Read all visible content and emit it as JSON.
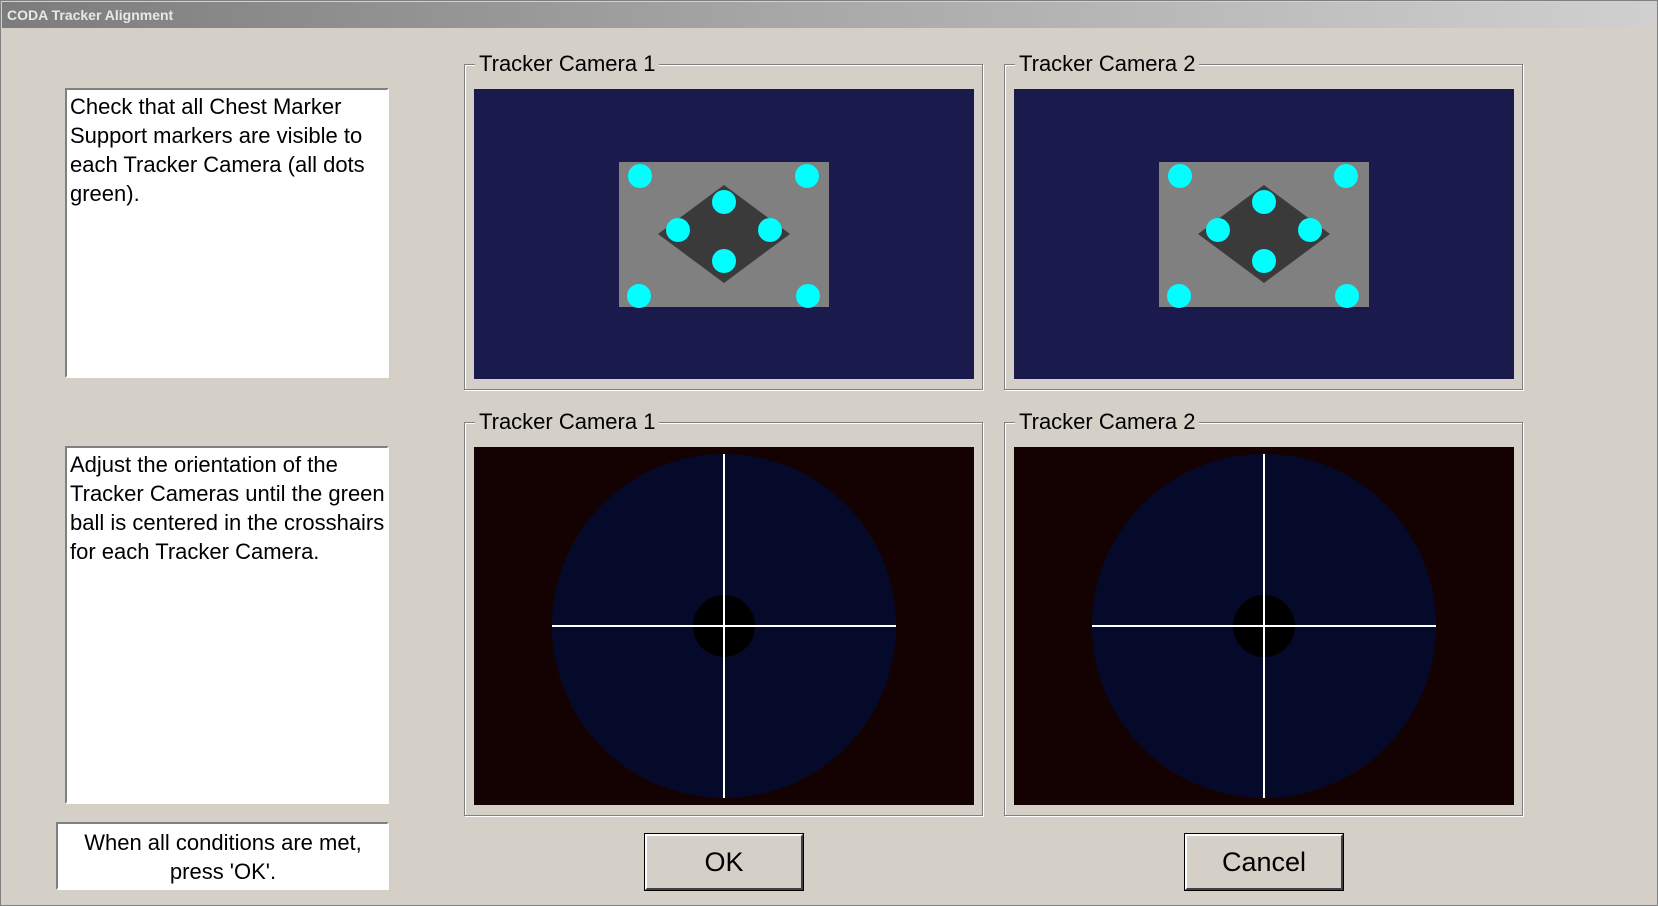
{
  "window": {
    "title": "CODA Tracker Alignment"
  },
  "instructions": {
    "markers": "Check that all Chest Marker Support markers are visible to each Tracker Camera (all dots green).",
    "orientation": "Adjust the orientation of the Tracker Cameras until the green ball is centered in the crosshairs for each Tracker Camera.",
    "final": "When all conditions are met, press 'OK'."
  },
  "groups": {
    "markers_cam1": {
      "label": "Tracker Camera 1"
    },
    "markers_cam2": {
      "label": "Tracker Camera 2"
    },
    "crosshair_cam1": {
      "label": "Tracker Camera 1"
    },
    "crosshair_cam2": {
      "label": "Tracker Camera 2"
    }
  },
  "buttons": {
    "ok": "OK",
    "cancel": "Cancel"
  },
  "colors": {
    "marker_view_bg": "#1b1a4c",
    "marker_plate": "#808080",
    "marker_diamond": "#3a3a3a",
    "marker_dot": "#00ffff",
    "crosshair_view_bg": "#140202",
    "crosshair_disc": "#050a2a",
    "crosshair_ball": "#000000",
    "crosshair_line": "#ffffff"
  },
  "icons": {
    "marker_dot": "circle-icon"
  }
}
